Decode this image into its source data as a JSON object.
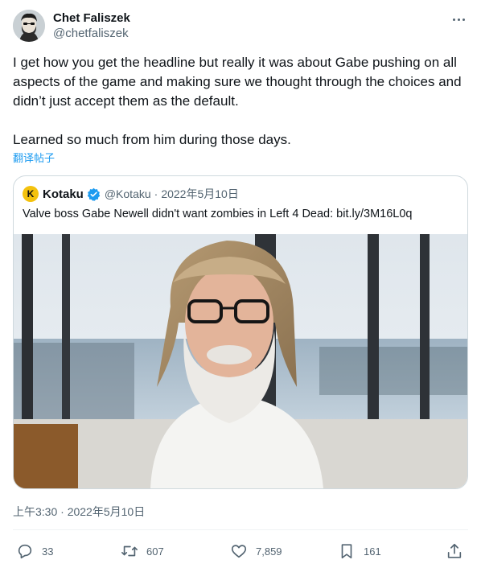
{
  "tweet": {
    "author_name": "Chet Faliszek",
    "author_handle": "@chetfaliszek",
    "text": "I get how you get the headline but really it was about Gabe pushing on all aspects of the game and making sure we thought through the choices and didn’t just accept them as the default.\n\nLearned so much from him during those days.",
    "translate_label": "翻译帖子",
    "timestamp": "上午3:30 · 2022年5月10日"
  },
  "quote": {
    "author_name": "Kotaku",
    "author_handle": "@Kotaku",
    "separator": "·",
    "date": "2022年5月10日",
    "text": "Valve boss Gabe Newell didn't want zombies in Left 4 Dead: bit.ly/3M16L0q",
    "logo_letter": "K"
  },
  "actions": {
    "replies": "33",
    "retweets": "607",
    "likes": "7,859",
    "bookmarks": "161"
  },
  "icons": {
    "reply": "reply-icon",
    "retweet": "retweet-icon",
    "like": "heart-icon",
    "bookmark": "bookmark-icon",
    "share": "share-icon",
    "verified": "verified-badge-icon",
    "more": "more-options-icon"
  },
  "colors": {
    "link": "#1d9bf0",
    "secondary_text": "#536471",
    "verified": "#1d9bf0",
    "kotaku_logo": "#f4c20d"
  }
}
